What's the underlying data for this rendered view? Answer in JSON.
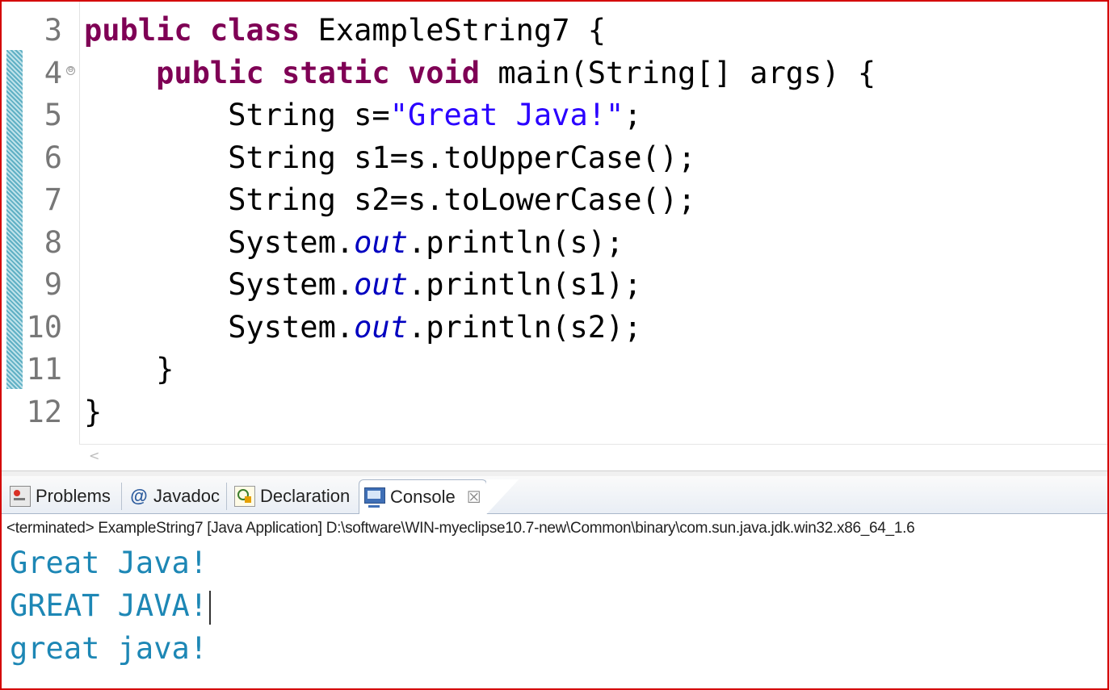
{
  "editor": {
    "lines": [
      {
        "num": "3",
        "parts": [
          [
            "kw",
            "public"
          ],
          [
            "t",
            " "
          ],
          [
            "kw",
            "class"
          ],
          [
            "t",
            " ExampleString7 {"
          ]
        ]
      },
      {
        "num": "4",
        "parts": [
          [
            "t",
            "    "
          ],
          [
            "kw",
            "public"
          ],
          [
            "t",
            " "
          ],
          [
            "kw",
            "static"
          ],
          [
            "t",
            " "
          ],
          [
            "kw",
            "void"
          ],
          [
            "t",
            " main(String[] args) {"
          ]
        ]
      },
      {
        "num": "5",
        "parts": [
          [
            "t",
            "        String s="
          ],
          [
            "str",
            "\"Great Java!\""
          ],
          [
            "t",
            ";"
          ]
        ]
      },
      {
        "num": "6",
        "parts": [
          [
            "t",
            "        String s1=s.toUpperCase();"
          ]
        ]
      },
      {
        "num": "7",
        "parts": [
          [
            "t",
            "        String s2=s.toLowerCase();"
          ]
        ]
      },
      {
        "num": "8",
        "parts": [
          [
            "t",
            "        System."
          ],
          [
            "fld",
            "out"
          ],
          [
            "t",
            ".println(s);"
          ]
        ]
      },
      {
        "num": "9",
        "parts": [
          [
            "t",
            "        System."
          ],
          [
            "fld",
            "out"
          ],
          [
            "t",
            ".println(s1);"
          ]
        ]
      },
      {
        "num": "10",
        "parts": [
          [
            "t",
            "        System."
          ],
          [
            "fld",
            "out"
          ],
          [
            "t",
            ".println(s2);"
          ]
        ]
      },
      {
        "num": "11",
        "parts": [
          [
            "t",
            "    }"
          ]
        ]
      },
      {
        "num": "12",
        "parts": [
          [
            "t",
            "}"
          ]
        ]
      }
    ],
    "fold_marker": "⊖",
    "scroll_left_glyph": "<"
  },
  "tabs": [
    {
      "label": "Problems",
      "icon": "problems-icon",
      "active": false
    },
    {
      "label": "Javadoc",
      "icon": "javadoc-icon",
      "active": false
    },
    {
      "label": "Declaration",
      "icon": "declaration-icon",
      "active": false
    },
    {
      "label": "Console",
      "icon": "console-icon",
      "active": true
    }
  ],
  "tab_close_glyph": "☒",
  "javadoc_glyph": "@",
  "console": {
    "status": "<terminated> ExampleString7 [Java Application] D:\\software\\WIN-myeclipse10.7-new\\Common\\binary\\com.sun.java.jdk.win32.x86_64_1.6",
    "output": [
      "Great Java!",
      "GREAT JAVA!",
      "great java!"
    ]
  },
  "colors": {
    "keyword": "#7f0055",
    "string": "#2a00ff",
    "field": "#0000c0",
    "console_output": "#1d87b5",
    "frame_border": "#d40000"
  }
}
